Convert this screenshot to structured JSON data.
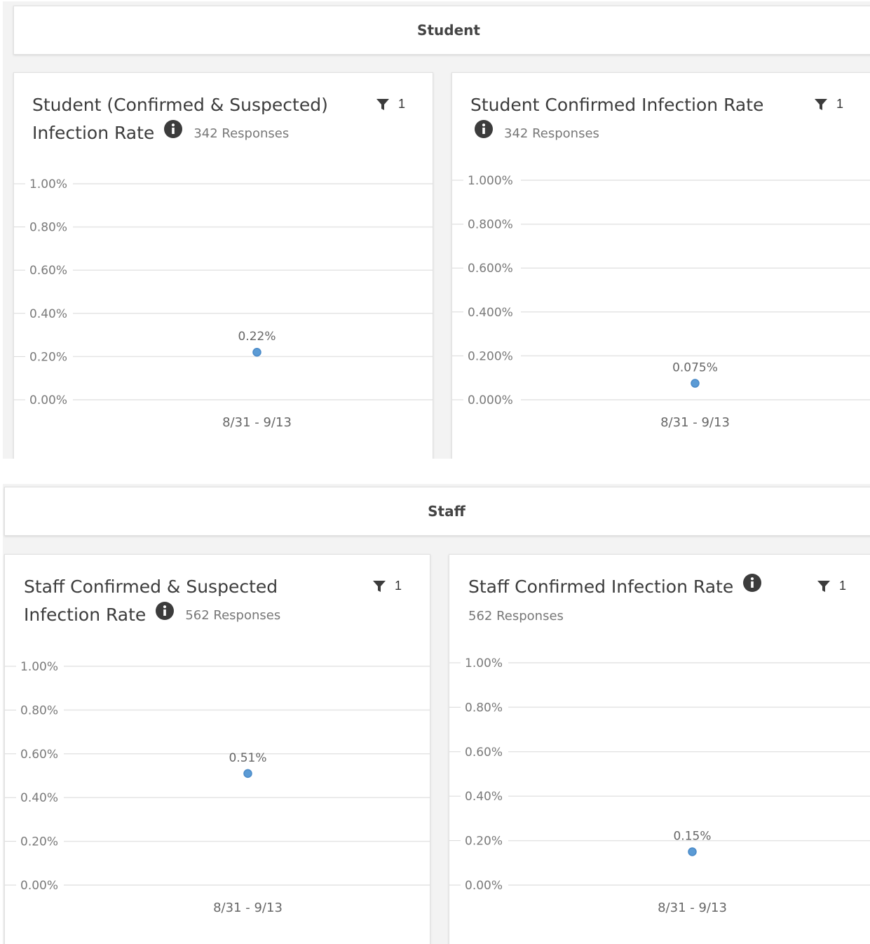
{
  "sections": [
    {
      "heading": "Student",
      "cards": [
        {
          "title_line1": "Student (Confirmed & Suspected)",
          "title_line2": "Infection Rate",
          "responses": "342 Responses",
          "filter_count": "1",
          "icon": "info-icon"
        },
        {
          "title_line1": "Student Confirmed Infection Rate",
          "title_line2": "",
          "responses": "342 Responses",
          "filter_count": "1",
          "icon": "info-icon"
        }
      ]
    },
    {
      "heading": "Staff",
      "cards": [
        {
          "title_line1": "Staff Confirmed & Suspected",
          "title_line2": "Infection Rate",
          "responses": "562 Responses",
          "filter_count": "1",
          "icon": "info-icon"
        },
        {
          "title_line1": "Staff Confirmed Infection Rate",
          "title_line2": "",
          "responses": "562 Responses",
          "filter_count": "1",
          "icon": "info-icon"
        }
      ]
    }
  ],
  "colors": {
    "point": "#5b9bd5",
    "grid": "#e4e4e4",
    "section_bg": "#f3f3f3"
  },
  "chart_data": [
    {
      "type": "scatter",
      "title": "Student (Confirmed & Suspected) Infection Rate",
      "categories": [
        "8/31 - 9/13"
      ],
      "values": [
        0.22
      ],
      "data_labels": [
        "0.22%"
      ],
      "ylim": [
        0,
        1.0
      ],
      "yticks": [
        "0.00%",
        "0.20%",
        "0.40%",
        "0.60%",
        "0.80%",
        "1.00%"
      ],
      "grid": true
    },
    {
      "type": "scatter",
      "title": "Student Confirmed Infection Rate",
      "categories": [
        "8/31 - 9/13"
      ],
      "values": [
        0.075
      ],
      "data_labels": [
        "0.075%"
      ],
      "ylim": [
        0,
        1.0
      ],
      "yticks": [
        "0.000%",
        "0.200%",
        "0.400%",
        "0.600%",
        "0.800%",
        "1.000%"
      ],
      "grid": true
    },
    {
      "type": "scatter",
      "title": "Staff Confirmed & Suspected Infection Rate",
      "categories": [
        "8/31 - 9/13"
      ],
      "values": [
        0.51
      ],
      "data_labels": [
        "0.51%"
      ],
      "ylim": [
        0,
        1.0
      ],
      "yticks": [
        "0.00%",
        "0.20%",
        "0.40%",
        "0.60%",
        "0.80%",
        "1.00%"
      ],
      "grid": true
    },
    {
      "type": "scatter",
      "title": "Staff Confirmed Infection Rate",
      "categories": [
        "8/31 - 9/13"
      ],
      "values": [
        0.15
      ],
      "data_labels": [
        "0.15%"
      ],
      "ylim": [
        0,
        1.0
      ],
      "yticks": [
        "0.00%",
        "0.20%",
        "0.40%",
        "0.60%",
        "0.80%",
        "1.00%"
      ],
      "grid": true
    }
  ]
}
